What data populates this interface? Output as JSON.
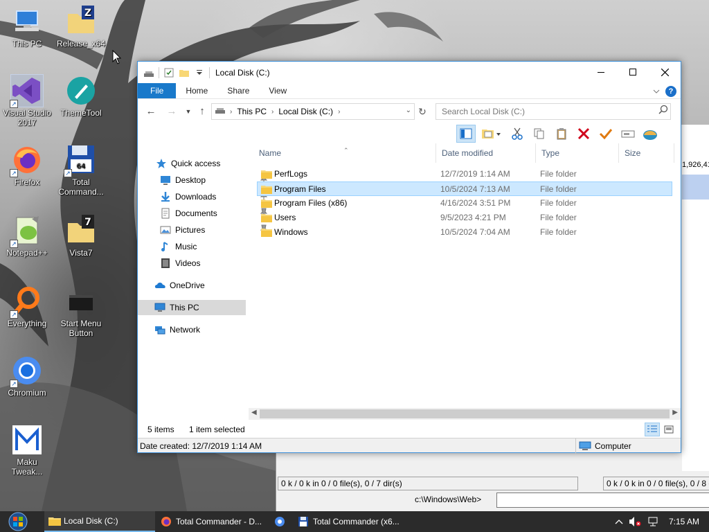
{
  "desktop": {
    "icons": [
      {
        "label": "This PC"
      },
      {
        "label": "Release_x64"
      },
      {
        "label": "Visual Studio 2017"
      },
      {
        "label": "ThemeTool"
      },
      {
        "label": "Firefox"
      },
      {
        "label": "Total Command..."
      },
      {
        "label": "Notepad++"
      },
      {
        "label": "Vista7"
      },
      {
        "label": "Everything"
      },
      {
        "label": "Start Menu Button"
      },
      {
        "label": "Chromium"
      },
      {
        "label": "Maku Tweak..."
      }
    ]
  },
  "total_commander_bg": {
    "partial_number": "1,926,41",
    "left_status": "0 k / 0 k in 0 / 0 file(s), 0 / 7 dir(s)",
    "right_status": "0 k / 0 k in 0 / 0 file(s), 0 / 8 d",
    "cmd_path": "c:\\Windows\\Web>"
  },
  "explorer": {
    "title": "Local Disk (C:)",
    "ribbon_tabs": [
      "File",
      "Home",
      "Share",
      "View"
    ],
    "address": {
      "crumbs": [
        "This PC",
        "Local Disk (C:)"
      ]
    },
    "search": {
      "placeholder": "Search Local Disk (C:)"
    },
    "nav": {
      "quick_access": "Quick access",
      "items": [
        {
          "label": "Desktop",
          "icon": "desktop-icon",
          "pinned": true
        },
        {
          "label": "Downloads",
          "icon": "downloads-icon",
          "pinned": true
        },
        {
          "label": "Documents",
          "icon": "documents-icon",
          "pinned": true
        },
        {
          "label": "Pictures",
          "icon": "pictures-icon",
          "pinned": true
        },
        {
          "label": "Music",
          "icon": "music-icon",
          "pinned": false
        },
        {
          "label": "Videos",
          "icon": "videos-icon",
          "pinned": false
        }
      ],
      "onedrive": "OneDrive",
      "this_pc": "This PC",
      "network": "Network"
    },
    "columns": {
      "name": "Name",
      "date": "Date modified",
      "type": "Type",
      "size": "Size"
    },
    "files": [
      {
        "name": "PerfLogs",
        "date": "12/7/2019 1:14 AM",
        "type": "File folder",
        "selected": false
      },
      {
        "name": "Program Files",
        "date": "10/5/2024 7:13 AM",
        "type": "File folder",
        "selected": true
      },
      {
        "name": "Program Files (x86)",
        "date": "4/16/2024 3:51 PM",
        "type": "File folder",
        "selected": false
      },
      {
        "name": "Users",
        "date": "9/5/2023 4:21 PM",
        "type": "File folder",
        "selected": false
      },
      {
        "name": "Windows",
        "date": "10/5/2024 7:04 AM",
        "type": "File folder",
        "selected": false
      }
    ],
    "status": {
      "count": "5 items",
      "selected": "1 item selected"
    },
    "details": {
      "created": "Date created: 12/7/2019 1:14 AM",
      "zone": "Computer"
    }
  },
  "taskbar": {
    "tasks": [
      {
        "label": "Local Disk (C:)",
        "icon": "folder-icon",
        "active": true
      },
      {
        "label": "Total Commander - D...",
        "icon": "firefox-icon",
        "active": false
      },
      {
        "label": "",
        "icon": "chromium-icon",
        "active": false
      },
      {
        "label": "Total Commander (x6...",
        "icon": "total-commander-icon",
        "active": false
      }
    ],
    "clock": "7:15 AM"
  },
  "colors": {
    "accent": "#1979ca",
    "selection": "#cce8ff",
    "folder": "#f8d775",
    "taskbar": "#2b2b2b"
  }
}
